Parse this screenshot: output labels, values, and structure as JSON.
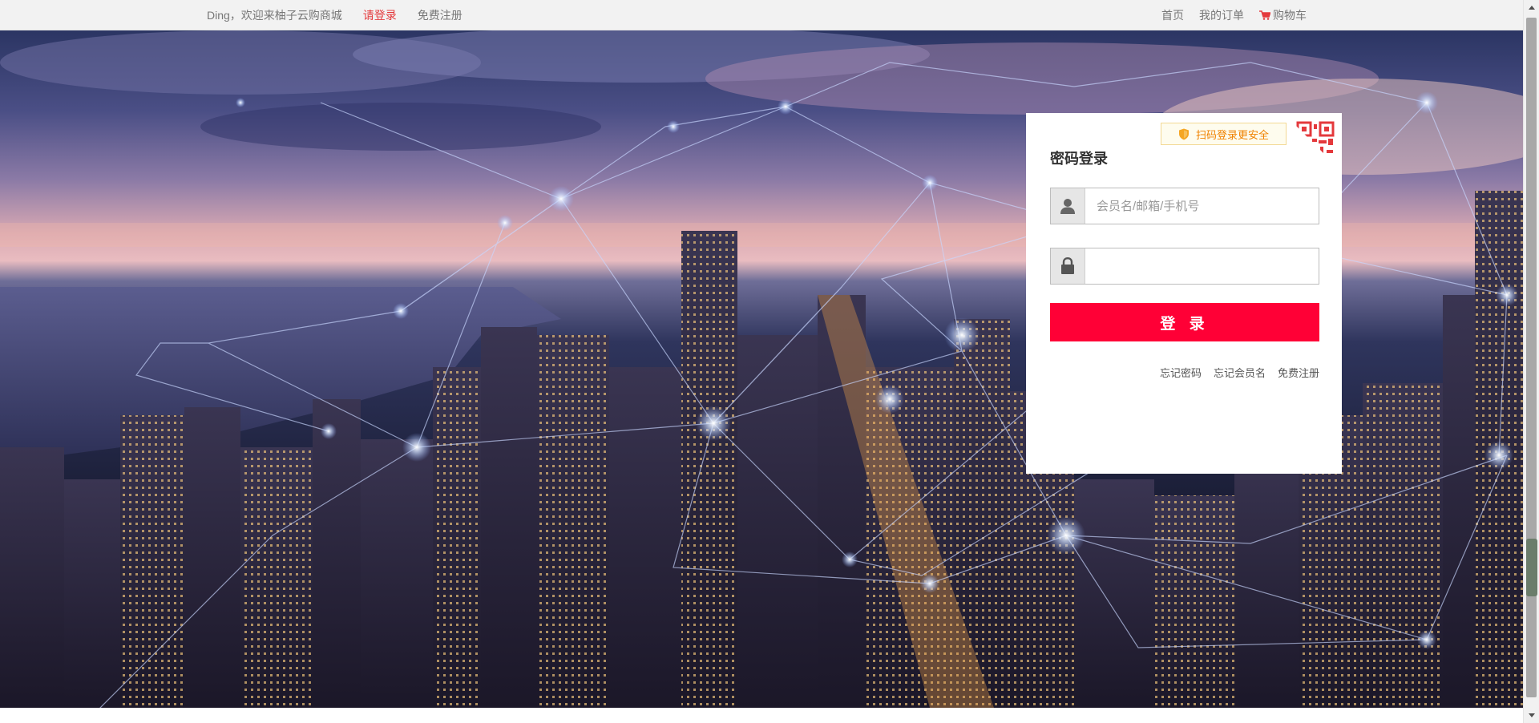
{
  "topbar": {
    "welcome": "Ding，欢迎来柚子云购商城",
    "login_link": "请登录",
    "register_link": "免费注册",
    "nav": {
      "home": "首页",
      "orders": "我的订单",
      "cart": "购物车"
    },
    "cart_icon": "cart-icon"
  },
  "login": {
    "title": "密码登录",
    "scan_tip": "扫码登录更安全",
    "username_placeholder": "会员名/邮箱/手机号",
    "password_value": "",
    "submit_label": "登 录",
    "links": {
      "forgot_password": "忘记密码",
      "forgot_username": "忘记会员名",
      "register": "免费注册"
    },
    "icons": {
      "user": "user-icon",
      "lock": "lock-icon",
      "shield": "shield-icon",
      "qr": "qr-code-icon"
    }
  },
  "colors": {
    "accent_red": "#ff0036",
    "link_red": "#e4393c",
    "tip_orange": "#f08200",
    "tip_bg": "#fefcee"
  }
}
